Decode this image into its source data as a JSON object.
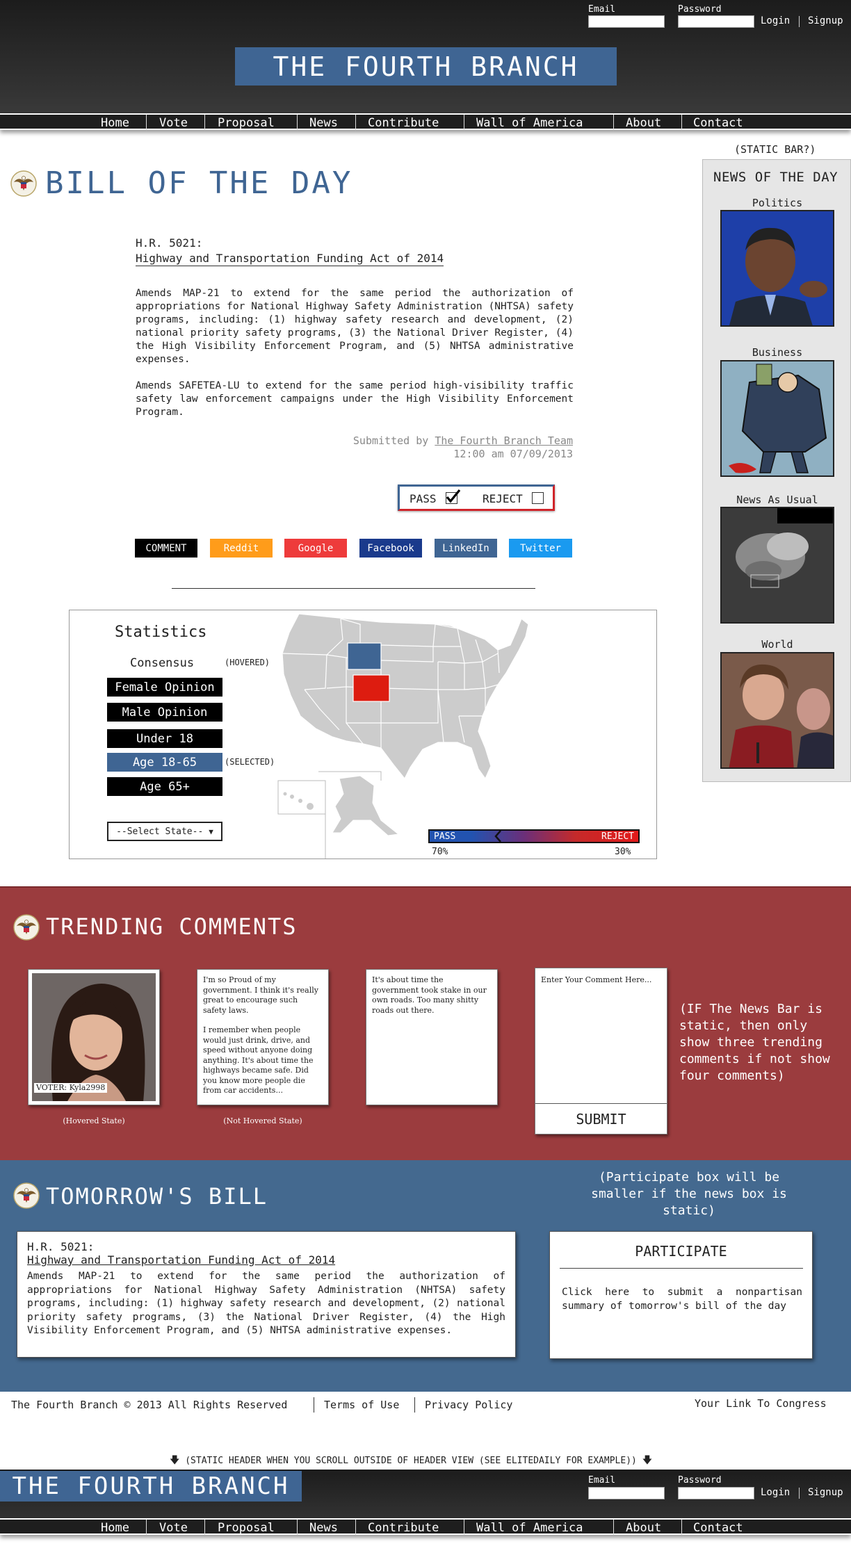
{
  "header": {
    "email_label": "Email",
    "password_label": "Password",
    "login": "Login",
    "signup": "Signup",
    "logo": "THE FOURTH BRANCH"
  },
  "nav": [
    "Home",
    "Vote",
    "Proposal",
    "News",
    "Contribute",
    "Wall of America",
    "About",
    "Contact"
  ],
  "bill": {
    "section_title": "BILL OF THE DAY",
    "number": "H.R. 5021:",
    "name": "Highway and Transportation Funding Act of 2014",
    "para1": "Amends MAP-21 to extend for the same period the authorization of appropriations for National Highway Safety Administration (NHTSA) safety programs, including: (1) highway safety research and development, (2) national priority safety programs, (3) the National Driver Register, (4) the High Visibility Enforcement Program, and (5) NHTSA administrative expenses.",
    "para2": "Amends SAFETEA-LU to extend for the same period high-visibility traffic safety law enforcement campaigns under the High Visibility Enforcement Program.",
    "submitted_prefix": "Submitted by",
    "submitted_by": "The Fourth Branch Team",
    "timestamp": "12:00 am 07/09/2013",
    "pass_label": "PASS",
    "reject_label": "REJECT",
    "pass_checked": true,
    "reject_checked": false
  },
  "share": {
    "comment": "COMMENT",
    "reddit": "Reddit",
    "google": "Google",
    "facebook": "Facebook",
    "linkedin": "LinkedIn",
    "twitter": "Twitter",
    "colors": {
      "comment": "#000000",
      "reddit": "#ff9c1a",
      "google": "#ee3b3b",
      "facebook": "#1a3a8c",
      "linkedin": "#3f6593",
      "twitter": "#1a9af0"
    }
  },
  "stats": {
    "title": "Statistics",
    "consensus": "Consensus",
    "hovered_note": "(HOVERED)",
    "selected_note": "(SELECTED)",
    "options": [
      "Female Opinion",
      "Male Opinion",
      "Under 18",
      "Age 18-65",
      "Age 65+"
    ],
    "selected_option": "Age 18-65",
    "select_state": "--Select State--",
    "legend_pass": "PASS",
    "legend_reject": "REJECT",
    "pass_pct": "70%",
    "reject_pct": "30%",
    "hovered_state_color": "#3f6593",
    "selected_state_color": "#dd1c10"
  },
  "news": {
    "static_label": "(STATIC BAR?)",
    "title": "NEWS OF THE DAY",
    "categories": [
      "Politics",
      "Business",
      "News As Usual",
      "World"
    ]
  },
  "trending": {
    "title": "TRENDING COMMENTS",
    "voter": "VOTER: Kyla2998",
    "hovered_note": "(Hovered State)",
    "not_hovered_note": "(Not Hovered State)",
    "comment1_p1": "I'm so Proud of my government. I think it's really great to encourage such safety laws.",
    "comment1_p2": "I remember when people would just drink, drive, and speed without anyone doing anything. It's about time the highways became safe. Did you know more people die from car accidents...",
    "comment2": "It's about time the government took stake in our own roads. Too many shitty roads out there.",
    "comment_placeholder": "Enter Your Comment Here...",
    "submit": "SUBMIT",
    "side_note": "(IF The News Bar is static, then only show three trending comments if not show four comments)"
  },
  "tomorrow": {
    "title": "TOMORROW'S BILL",
    "note": "(Participate box will be smaller if the news box is static)",
    "number": "H.R. 5021:",
    "name": "Highway and Transportation Funding Act of 2014",
    "desc": "Amends MAP-21 to extend for the same period the authorization of appropriations for National Highway Safety Administration (NHTSA) safety programs, including: (1) highway safety research and development, (2) national priority safety programs, (3) the National Driver Register, (4) the High Visibility Enforcement Program, and (5) NHTSA administrative expenses.",
    "participate_title": "PARTICIPATE",
    "participate_text": "Click here to submit a nonpartisan summary of tomorrow's bill of the day"
  },
  "footer": {
    "copyright": "The Fourth Branch © 2013 All Rights Reserved",
    "terms": "Terms of Use",
    "privacy": "Privacy Policy",
    "congress": "Your Link To Congress",
    "static_note": "(STATIC HEADER WHEN YOU SCROLL OUTSIDE OF HEADER VIEW (SEE ELITEDAILY FOR EXAMPLE))"
  }
}
